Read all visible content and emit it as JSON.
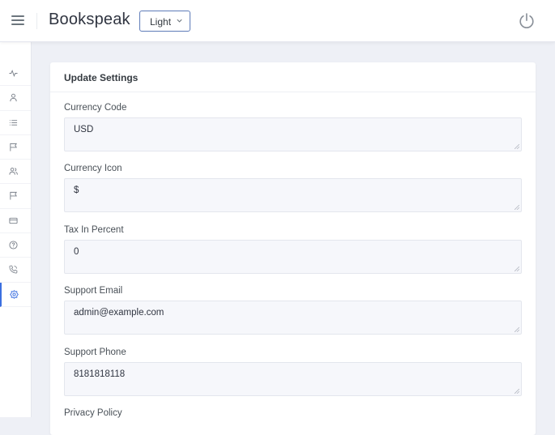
{
  "header": {
    "brand": "Bookspeak",
    "theme_select": {
      "value": "Light"
    }
  },
  "sidebar": {
    "items": [
      {
        "icon": "activity-icon"
      },
      {
        "icon": "user-icon"
      },
      {
        "icon": "list-icon"
      },
      {
        "icon": "flag-icon"
      },
      {
        "icon": "users-icon"
      },
      {
        "icon": "flag-icon"
      },
      {
        "icon": "credit-card-icon"
      },
      {
        "icon": "help-circle-icon"
      },
      {
        "icon": "phone-icon"
      },
      {
        "icon": "settings-icon",
        "active": true
      }
    ],
    "accent": "#3b6fe0"
  },
  "settings": {
    "title": "Update Settings",
    "fields": [
      {
        "label": "Currency Code",
        "value": "USD"
      },
      {
        "label": "Currency Icon",
        "value": "$"
      },
      {
        "label": "Tax In Percent",
        "value": "0"
      },
      {
        "label": "Support Email",
        "value": "admin@example.com"
      },
      {
        "label": "Support Phone",
        "value": "8181818118"
      },
      {
        "label": "Privacy Policy"
      }
    ]
  }
}
